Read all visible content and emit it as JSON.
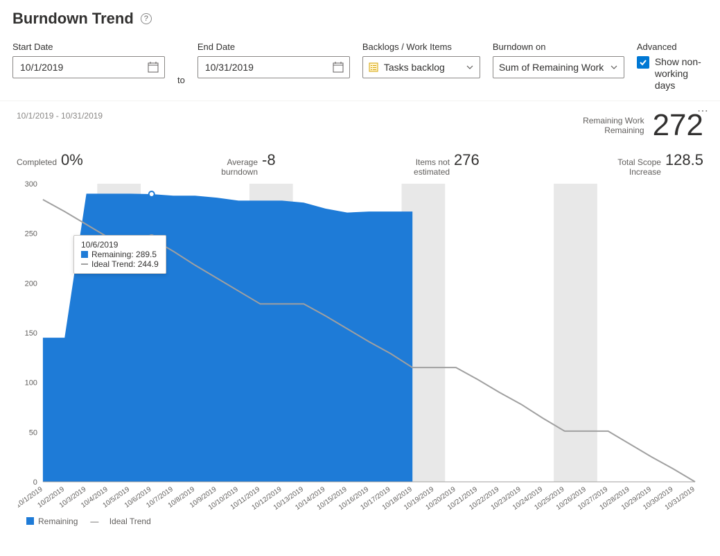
{
  "header": {
    "title": "Burndown Trend"
  },
  "controls": {
    "start_label": "Start Date",
    "end_label": "End Date",
    "start_value": "10/1/2019",
    "end_value": "10/31/2019",
    "to": "to",
    "backlogs_label": "Backlogs / Work Items",
    "backlogs_value": "Tasks backlog",
    "burn_label": "Burndown on",
    "burn_value": "Sum of Remaining Work",
    "advanced_label": "Advanced",
    "show_nonworking": "Show non-working days"
  },
  "widget": {
    "date_range": "10/1/2019 - 10/31/2019",
    "remaining_label1": "Remaining Work",
    "remaining_label2": "Remaining",
    "remaining_value": "272",
    "stats": {
      "completed_label": "Completed",
      "completed_value": "0%",
      "avg_label": "Average\nburndown",
      "avg_value": "-8",
      "items_label": "Items not\nestimated",
      "items_value": "276",
      "scope_label": "Total Scope\nIncrease",
      "scope_value": "128.5"
    }
  },
  "tooltip": {
    "date": "10/6/2019",
    "remaining_label": "Remaining: 289.5",
    "ideal_label": "Ideal Trend: 244.9"
  },
  "legend": {
    "remaining": "Remaining",
    "ideal": "Ideal Trend"
  },
  "colors": {
    "blue": "#1e7bd7",
    "gray": "#a0a0a0",
    "bandgray": "#e8e8e8",
    "axis": "#a19f9d"
  },
  "chart_data": {
    "type": "area+line",
    "title": "Burndown Trend",
    "ylabel": "",
    "xlabel": "",
    "ylim": [
      0,
      300
    ],
    "yticks": [
      0,
      50,
      100,
      150,
      200,
      250,
      300
    ],
    "categories": [
      "10/1/2019",
      "10/2/2019",
      "10/3/2019",
      "10/4/2019",
      "10/5/2019",
      "10/6/2019",
      "10/7/2019",
      "10/8/2019",
      "10/9/2019",
      "10/10/2019",
      "10/11/2019",
      "10/12/2019",
      "10/13/2019",
      "10/14/2019",
      "10/15/2019",
      "10/16/2019",
      "10/17/2019",
      "10/18/2019",
      "10/19/2019",
      "10/20/2019",
      "10/21/2019",
      "10/22/2019",
      "10/23/2019",
      "10/24/2019",
      "10/25/2019",
      "10/26/2019",
      "10/27/2019",
      "10/28/2019",
      "10/29/2019",
      "10/30/2019",
      "10/31/2019"
    ],
    "series": [
      {
        "name": "Remaining",
        "type": "area",
        "color": "#1e7bd7",
        "values": [
          145,
          145,
          290,
          290,
          290,
          289.5,
          288,
          288,
          286,
          283,
          283,
          283,
          281,
          275,
          271,
          272,
          272,
          272,
          null,
          null,
          null,
          null,
          null,
          null,
          null,
          null,
          null,
          null,
          null,
          null,
          null
        ]
      },
      {
        "name": "Ideal Trend",
        "type": "line",
        "color": "#a0a0a0",
        "values": [
          284,
          272,
          259,
          246,
          246,
          244.9,
          232,
          218,
          205,
          192,
          179,
          179,
          179,
          167,
          154,
          141,
          129,
          115,
          115,
          115,
          103,
          90,
          78,
          64,
          51,
          51,
          51,
          38,
          25,
          13,
          0
        ]
      }
    ],
    "non_working_bands": [
      [
        3,
        4
      ],
      [
        10,
        11
      ],
      [
        17,
        18
      ],
      [
        24,
        25
      ]
    ],
    "highlight_index": 5,
    "highlight": {
      "date": "10/6/2019",
      "remaining": 289.5,
      "ideal": 244.9
    },
    "annotations": []
  }
}
